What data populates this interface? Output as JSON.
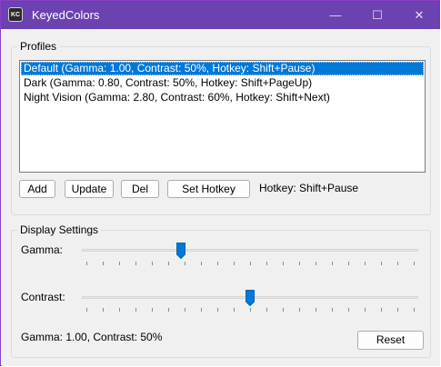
{
  "window": {
    "title": "KeyedColors",
    "icon_text": "KC",
    "accent_color": "#6b42b0",
    "controls": {
      "minimize": "—",
      "maximize": "☐",
      "close": "✕"
    }
  },
  "profiles": {
    "group_label": "Profiles",
    "items": [
      {
        "label": "Default (Gamma: 1.00, Contrast: 50%, Hotkey: Shift+Pause)",
        "selected": true
      },
      {
        "label": "Dark (Gamma: 0.80, Contrast: 50%, Hotkey: Shift+PageUp)",
        "selected": false
      },
      {
        "label": "Night Vision (Gamma: 2.80, Contrast: 60%, Hotkey: Shift+Next)",
        "selected": false
      }
    ],
    "buttons": {
      "add": "Add",
      "update": "Update",
      "del": "Del",
      "set_hotkey": "Set Hotkey"
    },
    "hotkey_text": "Hotkey: Shift+Pause"
  },
  "display": {
    "group_label": "Display Settings",
    "gamma_label": "Gamma:",
    "gamma_value_fraction": 0.29,
    "contrast_label": "Contrast:",
    "contrast_value_fraction": 0.5,
    "status_text": "Gamma: 1.00, Contrast: 50%",
    "reset_label": "Reset",
    "slider_color": "#0078d7"
  }
}
